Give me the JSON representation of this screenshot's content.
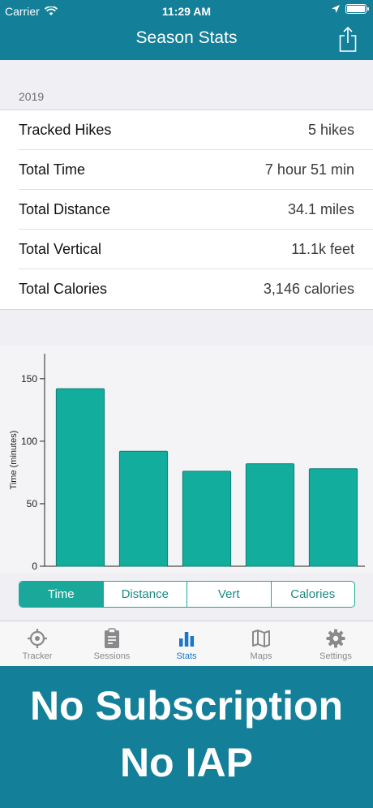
{
  "status_bar": {
    "carrier": "Carrier",
    "time": "11:29 AM"
  },
  "header": {
    "title": "Season Stats"
  },
  "section": {
    "label": "2019"
  },
  "stats": [
    {
      "label": "Tracked Hikes",
      "value": "5 hikes"
    },
    {
      "label": "Total Time",
      "value": "7 hour 51 min"
    },
    {
      "label": "Total Distance",
      "value": "34.1 miles"
    },
    {
      "label": "Total Vertical",
      "value": "11.1k feet"
    },
    {
      "label": "Total Calories",
      "value": "3,146 calories"
    }
  ],
  "chart_data": {
    "type": "bar",
    "ylabel": "Time (minutes)",
    "ylim": [
      0,
      170
    ],
    "yticks": [
      "0",
      "50",
      "100",
      "150"
    ],
    "values": [
      142,
      92,
      76,
      82,
      78
    ],
    "color": "#13ad9e"
  },
  "segments": [
    {
      "label": "Time",
      "active": true
    },
    {
      "label": "Distance",
      "active": false
    },
    {
      "label": "Vert",
      "active": false
    },
    {
      "label": "Calories",
      "active": false
    }
  ],
  "tabs": [
    {
      "label": "Tracker",
      "icon": "target-icon"
    },
    {
      "label": "Sessions",
      "icon": "clipboard-icon"
    },
    {
      "label": "Stats",
      "icon": "bar-chart-icon",
      "active": true
    },
    {
      "label": "Maps",
      "icon": "map-icon"
    },
    {
      "label": "Settings",
      "icon": "gear-icon"
    }
  ],
  "promo": {
    "line1": "No Subscription",
    "line2": "No IAP"
  },
  "colors": {
    "header": "#137f98",
    "accent": "#13ad9e",
    "tab_active": "#1877c9"
  }
}
